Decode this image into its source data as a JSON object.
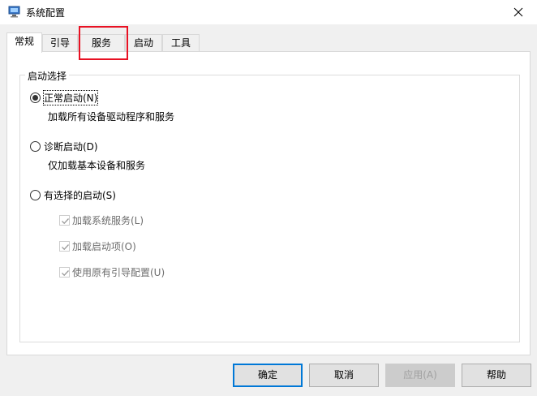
{
  "window": {
    "title": "系统配置",
    "icon": "msconfig-icon"
  },
  "tabs": [
    {
      "label": "常规",
      "active": true
    },
    {
      "label": "引导",
      "active": false
    },
    {
      "label": "服务",
      "active": false
    },
    {
      "label": "启动",
      "active": false
    },
    {
      "label": "工具",
      "active": false
    }
  ],
  "startup": {
    "legend": "启动选择",
    "normal": {
      "label": "正常启动(N)",
      "desc": "加载所有设备驱动程序和服务",
      "checked": true
    },
    "diagnostic": {
      "label": "诊断启动(D)",
      "desc": "仅加载基本设备和服务",
      "checked": false
    },
    "selective": {
      "label": "有选择的启动(S)",
      "checked": false,
      "options": [
        {
          "label": "加载系统服务(L)",
          "checked": true,
          "enabled": false
        },
        {
          "label": "加载启动项(O)",
          "checked": true,
          "enabled": false
        },
        {
          "label": "使用原有引导配置(U)",
          "checked": true,
          "enabled": false
        }
      ]
    }
  },
  "buttons": {
    "ok": "确定",
    "cancel": "取消",
    "apply": "应用(A)",
    "help": "帮助"
  },
  "colors": {
    "highlight": "#e81123",
    "default_button_border": "#0078d7"
  }
}
